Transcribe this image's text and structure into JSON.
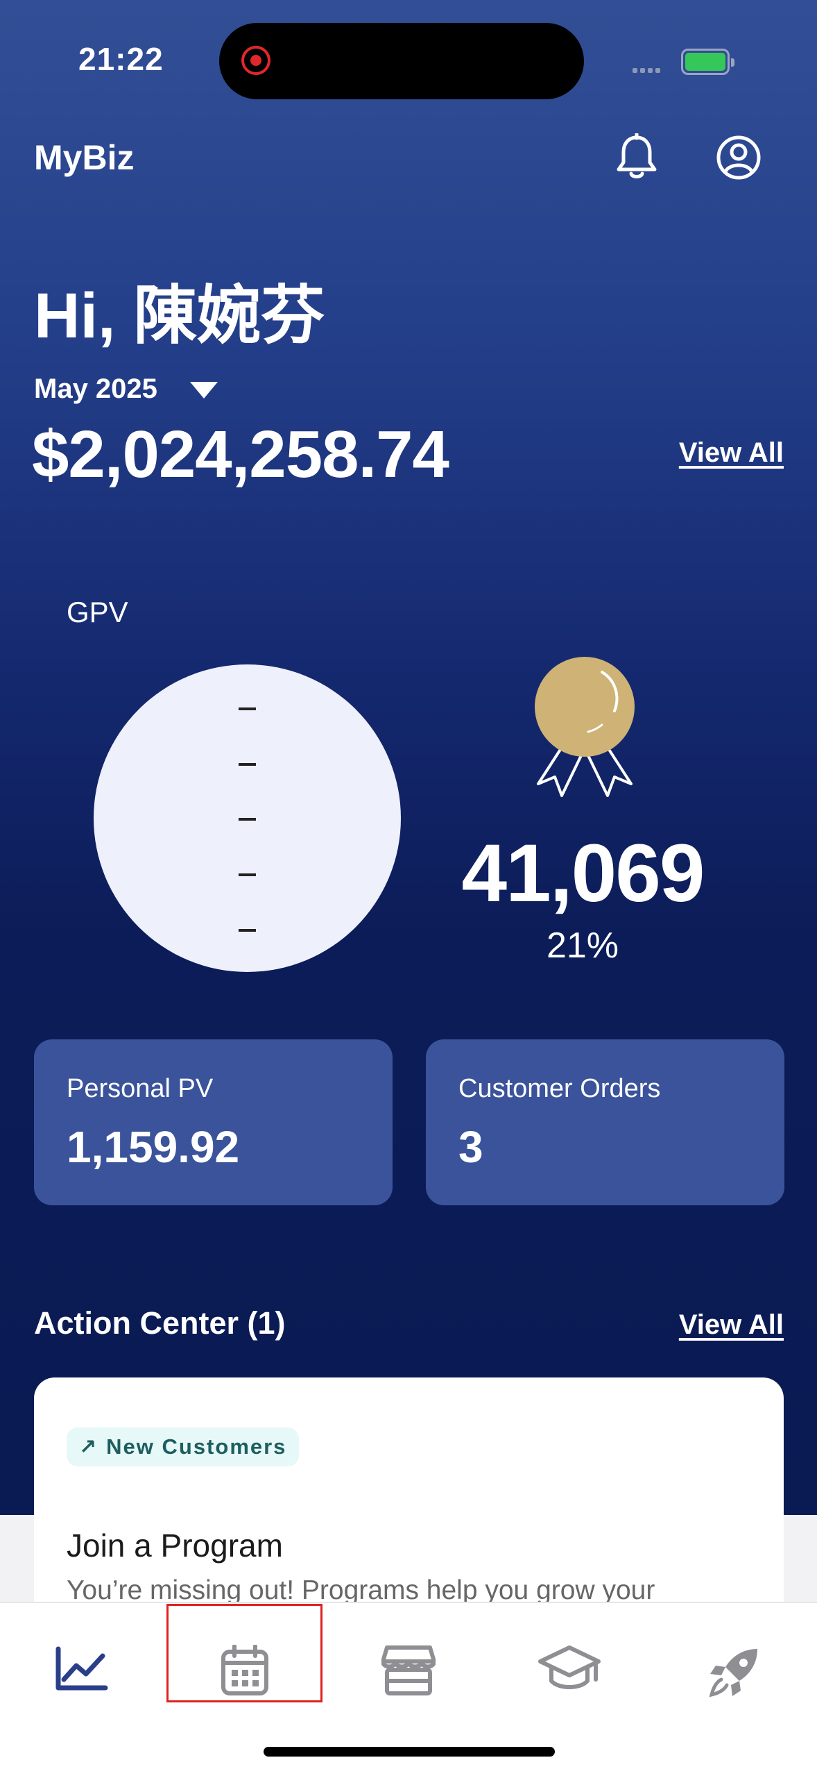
{
  "status_bar": {
    "time": "21:22"
  },
  "header": {
    "brand": "MyBiz"
  },
  "greeting": "Hi, 陳婉芬",
  "period": {
    "selected": "May 2025"
  },
  "summary": {
    "total": "$2,024,258.74",
    "view_all": "View All"
  },
  "gpv": {
    "label": "GPV",
    "value": "41,069",
    "percent": "21%"
  },
  "cards": [
    {
      "label": "Personal PV",
      "value": "1,159.92"
    },
    {
      "label": "Customer Orders",
      "value": "3"
    }
  ],
  "action_center": {
    "title": "Action Center (1)",
    "view_all": "View All",
    "item": {
      "tag": "New Customers",
      "title": "Join a Program",
      "description": "You’re missing out! Programs help you grow your"
    }
  },
  "bottom_nav": [
    {
      "icon": "chart-line-icon",
      "active": true
    },
    {
      "icon": "calendar-icon",
      "active": false
    },
    {
      "icon": "store-icon",
      "active": false
    },
    {
      "icon": "graduation-cap-icon",
      "active": false
    },
    {
      "icon": "rocket-icon",
      "active": false
    }
  ],
  "colors": {
    "accent": "#2a3f8a",
    "card": "#3a539b",
    "medal": "#cfb275",
    "tag_bg": "#e6f8f8",
    "tag_text": "#1d5e5f"
  }
}
